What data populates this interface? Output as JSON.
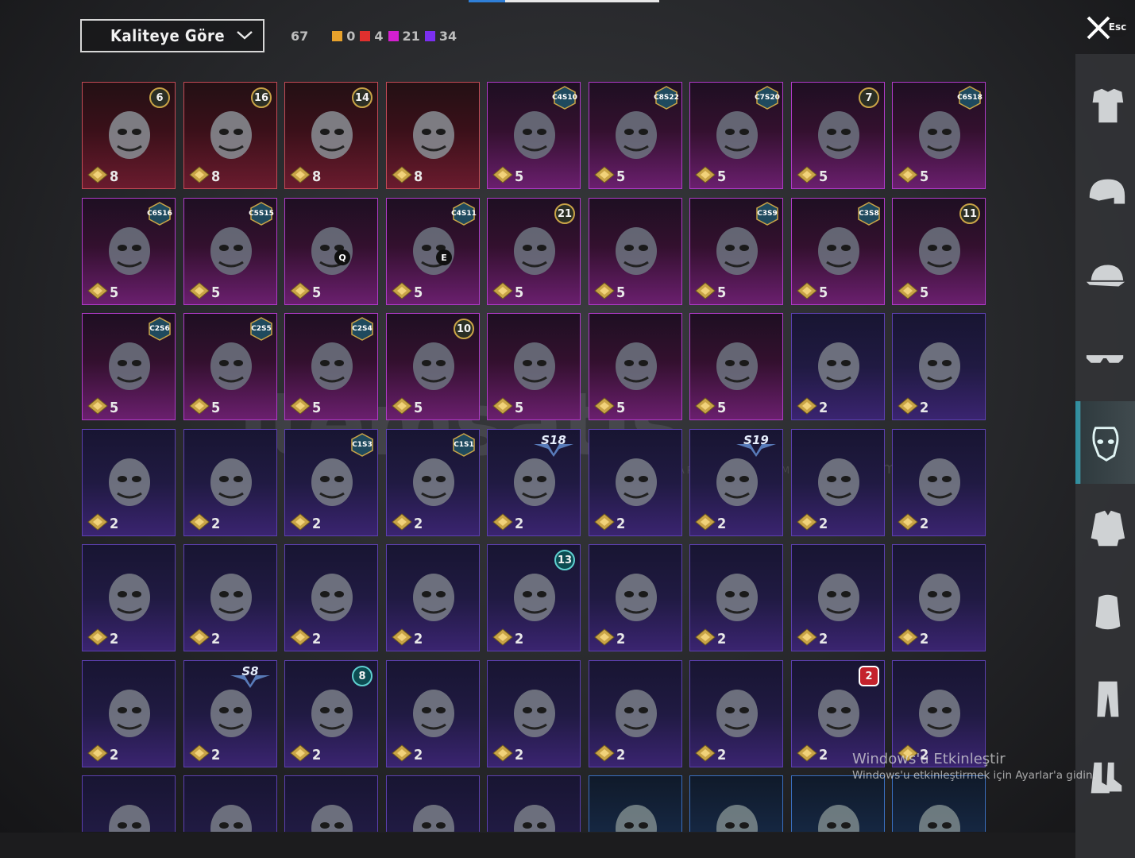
{
  "sort": {
    "label": "Kaliteye Göre"
  },
  "counts": {
    "total": "67",
    "qualities": [
      {
        "color": "#e8a22c",
        "value": "0"
      },
      {
        "color": "#e0302e",
        "value": "4"
      },
      {
        "color": "#d41fd0",
        "value": "21"
      },
      {
        "color": "#7b2ff0",
        "value": "34"
      }
    ]
  },
  "close": {
    "esc_label": "Esc"
  },
  "watermark": {
    "brand": "itemsatis",
    "tagline": "HESAP / SKIN / ITEM / E-PIN",
    "domain": ".com"
  },
  "activation": {
    "title": "Windows'u Etkinleştir",
    "subtitle": "Windows'u etkinleştirmek için Ayarlar'a gidin."
  },
  "items": [
    {
      "q": "red",
      "count": "8",
      "badge": {
        "type": "circle",
        "text": "6"
      },
      "icon": "plague-doctor-mask-icon"
    },
    {
      "q": "red",
      "count": "8",
      "badge": {
        "type": "circle",
        "text": "16"
      },
      "icon": "golden-helmet-mask-icon"
    },
    {
      "q": "red",
      "count": "8",
      "badge": {
        "type": "circle",
        "text": "14"
      },
      "icon": "golden-face-guard-icon"
    },
    {
      "q": "red",
      "count": "8",
      "badge": null,
      "icon": "black-skull-mask-icon"
    },
    {
      "q": "purple",
      "count": "5",
      "badge": {
        "type": "hex",
        "text": "C4S10"
      },
      "icon": "teal-mask-icon"
    },
    {
      "q": "purple",
      "count": "5",
      "badge": {
        "type": "hex",
        "text": "C8S22"
      },
      "icon": "black-ring-mask-icon"
    },
    {
      "q": "purple",
      "count": "5",
      "badge": {
        "type": "hex",
        "text": "C7S20"
      },
      "icon": "cyber-mask-icon"
    },
    {
      "q": "purple",
      "count": "5",
      "badge": {
        "type": "circle",
        "text": "7"
      },
      "icon": "earpiece-icon"
    },
    {
      "q": "purple",
      "count": "5",
      "badge": {
        "type": "hex",
        "text": "C6S18"
      },
      "icon": "gold-claw-mask-icon"
    },
    {
      "q": "purple",
      "count": "5",
      "badge": {
        "type": "hex",
        "text": "C6S16"
      },
      "icon": "gas-mask-yellow-icon"
    },
    {
      "q": "purple",
      "count": "5",
      "badge": {
        "type": "hex",
        "text": "C5S15"
      },
      "icon": "respirator-white-icon"
    },
    {
      "q": "purple",
      "count": "5",
      "badge": null,
      "key": "Q",
      "icon": "dark-helmet-icon"
    },
    {
      "q": "purple",
      "count": "5",
      "badge": {
        "type": "hex",
        "text": "C4S11"
      },
      "key": "E",
      "icon": "visor-mask-icon"
    },
    {
      "q": "purple",
      "count": "5",
      "badge": {
        "type": "circle",
        "text": "21"
      },
      "icon": "vampire-mask-icon"
    },
    {
      "q": "purple",
      "count": "5",
      "badge": null,
      "icon": "kitsune-mask-icon"
    },
    {
      "q": "purple",
      "count": "5",
      "badge": {
        "type": "hex",
        "text": "C3S9"
      },
      "icon": "pink-respirator-icon"
    },
    {
      "q": "purple",
      "count": "5",
      "badge": {
        "type": "hex",
        "text": "C3S8"
      },
      "icon": "grey-respirator-icon"
    },
    {
      "q": "purple",
      "count": "5",
      "badge": {
        "type": "circle",
        "text": "11"
      },
      "icon": "oni-mask-icon"
    },
    {
      "q": "purple",
      "count": "5",
      "badge": {
        "type": "hex",
        "text": "C2S6"
      },
      "icon": "tribal-mask-icon"
    },
    {
      "q": "purple",
      "count": "5",
      "badge": {
        "type": "hex",
        "text": "C2S5"
      },
      "icon": "purple-respirator-icon"
    },
    {
      "q": "purple",
      "count": "5",
      "badge": {
        "type": "hex",
        "text": "C2S4"
      },
      "icon": "gold-mech-mask-icon"
    },
    {
      "q": "purple",
      "count": "5",
      "badge": {
        "type": "circle",
        "text": "10"
      },
      "icon": "white-gas-mask-icon"
    },
    {
      "q": "purple",
      "count": "5",
      "badge": null,
      "icon": "cat-mask-icon"
    },
    {
      "q": "purple",
      "count": "5",
      "badge": null,
      "icon": "steampunk-beak-icon"
    },
    {
      "q": "purple",
      "count": "5",
      "badge": null,
      "icon": "skull-bandana-icon"
    },
    {
      "q": "violet",
      "count": "2",
      "badge": null,
      "icon": "half-face-mask-icon"
    },
    {
      "q": "violet",
      "count": "2",
      "badge": null,
      "icon": "red-eye-device-icon"
    },
    {
      "q": "violet",
      "count": "2",
      "badge": null,
      "icon": "walrus-mask-icon"
    },
    {
      "q": "violet",
      "count": "2",
      "badge": null,
      "icon": "pink-creature-mask-icon"
    },
    {
      "q": "violet",
      "count": "2",
      "badge": {
        "type": "hex",
        "text": "C1S3"
      },
      "icon": "cactus-bandana-icon"
    },
    {
      "q": "violet",
      "count": "2",
      "badge": {
        "type": "hex",
        "text": "C1S1"
      },
      "icon": "blue-wave-mask-icon"
    },
    {
      "q": "violet",
      "count": "2",
      "badge": {
        "type": "s",
        "text": "S18"
      },
      "icon": "heartbeat-mask-icon"
    },
    {
      "q": "violet",
      "count": "2",
      "badge": null,
      "icon": "skull-face-mask-icon"
    },
    {
      "q": "violet",
      "count": "2",
      "badge": {
        "type": "s",
        "text": "S19"
      },
      "icon": "neon-visor-icon"
    },
    {
      "q": "violet",
      "count": "2",
      "badge": null,
      "icon": "brown-bandana-icon"
    },
    {
      "q": "violet",
      "count": "2",
      "badge": null,
      "icon": "purple-goggle-mask-icon"
    },
    {
      "q": "violet",
      "count": "2",
      "badge": null,
      "icon": "neck-gaiter-icon"
    },
    {
      "q": "violet",
      "count": "2",
      "badge": null,
      "icon": "silver-respirator-icon"
    },
    {
      "q": "violet",
      "count": "2",
      "badge": null,
      "icon": "black-half-mask-icon"
    },
    {
      "q": "violet",
      "count": "2",
      "badge": null,
      "icon": "dark-bandana-icon"
    },
    {
      "q": "violet",
      "count": "2",
      "badge": {
        "type": "circle-teal",
        "text": "13"
      },
      "icon": "tech-gas-mask-icon"
    },
    {
      "q": "violet",
      "count": "2",
      "badge": null,
      "icon": "green-scarf-icon"
    },
    {
      "q": "violet",
      "count": "2",
      "badge": null,
      "icon": "mummy-wrap-icon"
    },
    {
      "q": "violet",
      "count": "2",
      "badge": null,
      "icon": "clown-mask-icon"
    },
    {
      "q": "violet",
      "count": "2",
      "badge": null,
      "icon": "monster-jaw-mask-icon"
    },
    {
      "q": "violet",
      "count": "2",
      "badge": null,
      "icon": "grey-face-mask-icon"
    },
    {
      "q": "violet",
      "count": "2",
      "badge": {
        "type": "s",
        "text": "S8"
      },
      "icon": "flame-bandana-icon"
    },
    {
      "q": "violet",
      "count": "2",
      "badge": {
        "type": "circle-teal",
        "text": "8"
      },
      "icon": "camo-hockey-mask-icon"
    },
    {
      "q": "violet",
      "count": "2",
      "badge": null,
      "icon": "black-welder-mask-icon"
    },
    {
      "q": "violet",
      "count": "2",
      "badge": null,
      "icon": "grin-face-mask-icon"
    },
    {
      "q": "violet",
      "count": "2",
      "badge": null,
      "icon": "shark-teeth-mask-icon"
    },
    {
      "q": "violet",
      "count": "2",
      "badge": null,
      "icon": "white-cloth-mask-icon"
    },
    {
      "q": "violet",
      "count": "2",
      "badge": {
        "type": "circle-red",
        "text": "2"
      },
      "icon": "heist-clown-mask-icon"
    },
    {
      "q": "violet",
      "count": "2",
      "badge": null,
      "icon": "dark-skull-mask-icon"
    },
    {
      "q": "violet",
      "count": "",
      "badge": null,
      "icon": "studded-mask-icon"
    },
    {
      "q": "violet",
      "count": "",
      "badge": null,
      "icon": "black-wrap-icon"
    },
    {
      "q": "violet",
      "count": "",
      "badge": null,
      "icon": "red-bandana-icon"
    },
    {
      "q": "violet",
      "count": "",
      "badge": null,
      "icon": "gold-sequin-mask-icon"
    },
    {
      "q": "violet",
      "count": "",
      "badge": null,
      "icon": "hockey-mask-icon"
    },
    {
      "q": "blue",
      "count": "",
      "badge": null,
      "icon": "rusty-mask-icon"
    },
    {
      "q": "blue",
      "count": "",
      "badge": null,
      "icon": "yellow-dots-mask-icon"
    },
    {
      "q": "blue",
      "count": "",
      "badge": null,
      "icon": "spider-web-mask-icon"
    },
    {
      "q": "blue",
      "count": "",
      "badge": null,
      "icon": "silver-face-mask-icon"
    }
  ],
  "sidebar": [
    {
      "name": "outfit-category",
      "icon": "outfit-icon",
      "active": false
    },
    {
      "name": "helmet-category",
      "icon": "helmet-icon",
      "active": false
    },
    {
      "name": "cap-category",
      "icon": "cap-icon",
      "active": false
    },
    {
      "name": "glasses-category",
      "icon": "glasses-icon",
      "active": false
    },
    {
      "name": "mask-category",
      "icon": "mask-icon",
      "active": true
    },
    {
      "name": "jacket-category",
      "icon": "jacket-icon",
      "active": false
    },
    {
      "name": "backpack-category",
      "icon": "backpack-icon",
      "active": false
    },
    {
      "name": "pants-category",
      "icon": "pants-icon",
      "active": false
    },
    {
      "name": "shoes-category",
      "icon": "shoes-icon",
      "active": false
    }
  ]
}
